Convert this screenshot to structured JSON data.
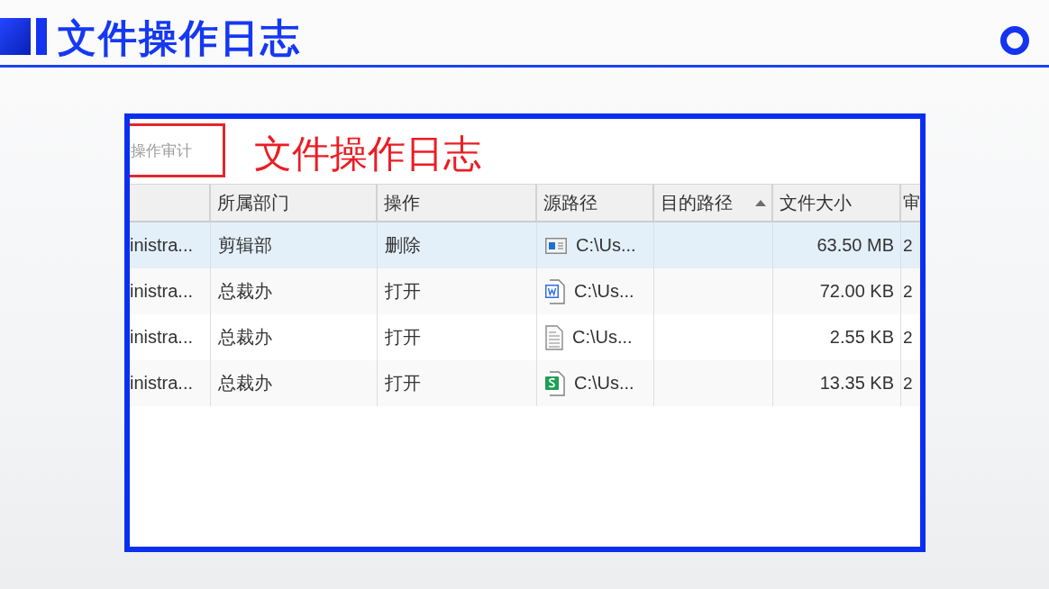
{
  "header": {
    "title": "文件操作日志"
  },
  "screenshot": {
    "tab": {
      "label": "操作审计",
      "highlighted": true
    },
    "annotation": "文件操作日志",
    "table": {
      "columns": [
        {
          "label": "所属部门",
          "sorted": false
        },
        {
          "label": "操作",
          "sorted": false
        },
        {
          "label": "源路径",
          "sorted": false
        },
        {
          "label": "目的路径",
          "sorted": true
        },
        {
          "label": "文件大小",
          "sorted": false
        },
        {
          "label": "审",
          "sorted": false
        }
      ],
      "rows": [
        {
          "selected": true,
          "column_1": "inistra...",
          "department": "剪辑部",
          "operation": "删除",
          "kind": "window",
          "source_path": "C:\\Us...",
          "file_size": "63.50 MB",
          "column_7": "2"
        },
        {
          "selected": false,
          "column_1": "inistra...",
          "department": "总裁办",
          "operation": "打开",
          "kind": "word",
          "source_path": "C:\\Us...",
          "file_size": "72.00 KB",
          "column_7": "2"
        },
        {
          "selected": false,
          "column_1": "inistra...",
          "department": "总裁办",
          "operation": "打开",
          "kind": "text",
          "source_path": "C:\\Us...",
          "file_size": "2.55 KB",
          "column_7": "2"
        },
        {
          "selected": false,
          "column_1": "inistra...",
          "department": "总裁办",
          "operation": "打开",
          "kind": "sheet",
          "source_path": "C:\\Us...",
          "file_size": "13.35 KB",
          "column_7": "2"
        }
      ]
    }
  }
}
